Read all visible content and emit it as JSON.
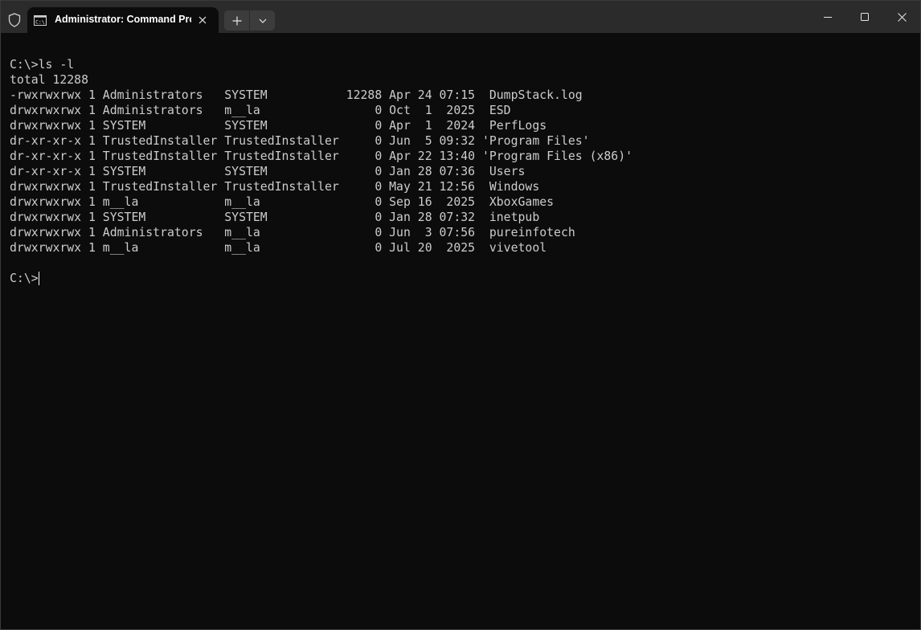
{
  "window": {
    "tab_title": "Administrator: Command Pro",
    "accent": "#0c0c0c"
  },
  "icons": {
    "shield": "shield-icon",
    "tab": "command-prompt-icon",
    "close_tab": "close-icon",
    "new_tab": "plus-icon",
    "dropdown": "chevron-down-icon",
    "minimize": "minimize-icon",
    "maximize": "maximize-icon",
    "close_window": "close-icon"
  },
  "terminal": {
    "lines": [
      "",
      "C:\\>ls -l",
      "total 12288",
      "-rwxrwxrwx 1 Administrators   SYSTEM           12288 Apr 24 07:15  DumpStack.log",
      "drwxrwxrwx 1 Administrators   m__la                0 Oct  1  2025  ESD",
      "drwxrwxrwx 1 SYSTEM           SYSTEM               0 Apr  1  2024  PerfLogs",
      "dr-xr-xr-x 1 TrustedInstaller TrustedInstaller     0 Jun  5 09:32 'Program Files'",
      "dr-xr-xr-x 1 TrustedInstaller TrustedInstaller     0 Apr 22 13:40 'Program Files (x86)'",
      "dr-xr-xr-x 1 SYSTEM           SYSTEM               0 Jan 28 07:36  Users",
      "drwxrwxrwx 1 TrustedInstaller TrustedInstaller     0 May 21 12:56  Windows",
      "drwxrwxrwx 1 m__la            m__la                0 Sep 16  2025  XboxGames",
      "drwxrwxrwx 1 SYSTEM           SYSTEM               0 Jan 28 07:32  inetpub",
      "drwxrwxrwx 1 Administrators   m__la                0 Jun  3 07:56  pureinfotech",
      "drwxrwxrwx 1 m__la            m__la                0 Jul 20  2025  vivetool",
      ""
    ],
    "prompt": "C:\\>"
  }
}
